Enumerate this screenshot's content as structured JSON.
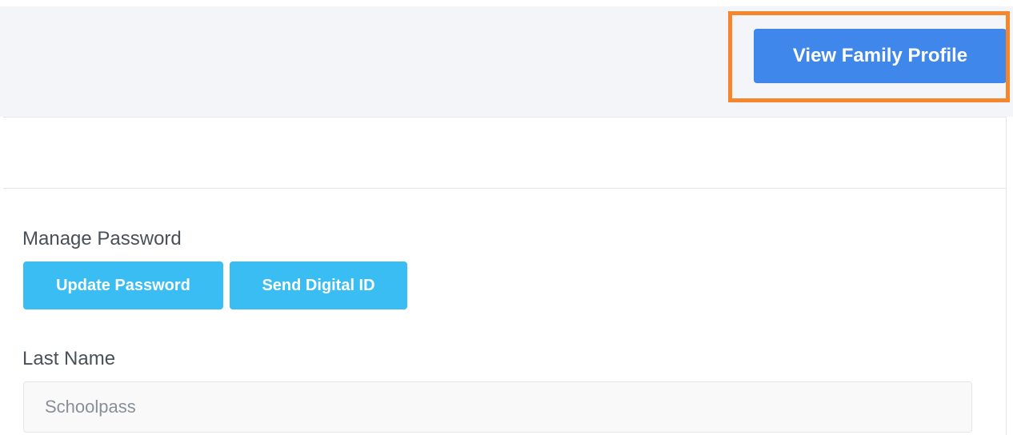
{
  "header": {
    "view_family_profile_label": "View Family Profile"
  },
  "form": {
    "manage_password_label": "Manage Password",
    "update_password_label": "Update Password",
    "send_digital_id_label": "Send Digital ID",
    "last_name_label": "Last Name",
    "last_name_value": "Schoolpass"
  },
  "colors": {
    "primary_button": "#3f87ea",
    "secondary_button": "#39bdf2",
    "highlight": "#f5862b",
    "band_background": "#f4f5f8"
  }
}
